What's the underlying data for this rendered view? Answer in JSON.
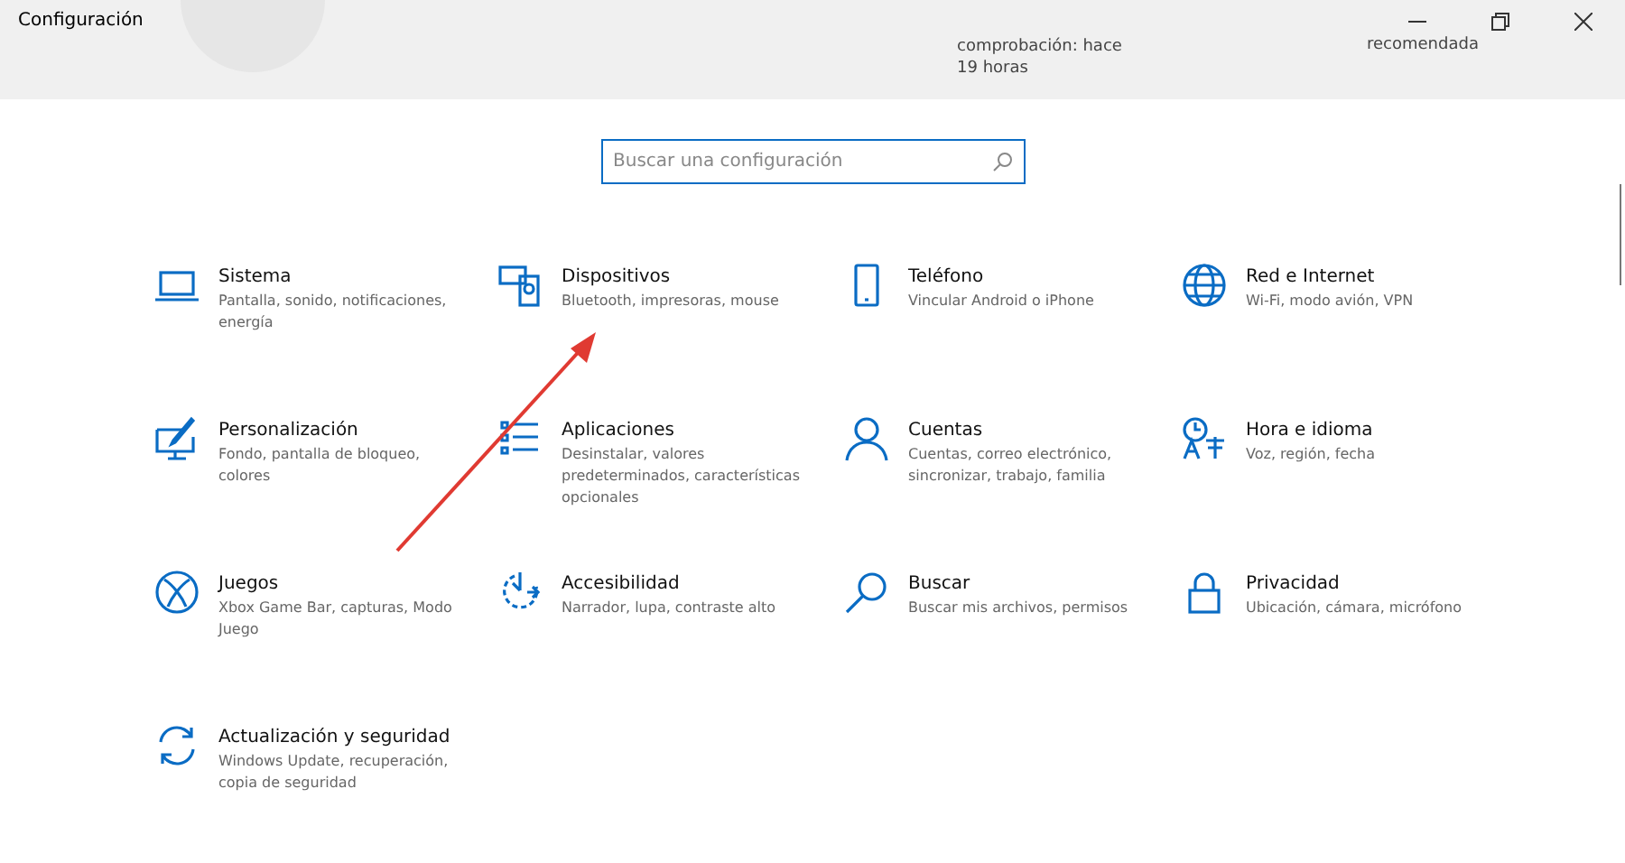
{
  "window": {
    "title": "Configuración"
  },
  "header": {
    "update_status": [
      "comprobación: hace",
      "19 horas"
    ],
    "recommended": "recomendada"
  },
  "search": {
    "placeholder": "Buscar una configuración"
  },
  "categories": [
    {
      "kind": "laptop",
      "title": "Sistema",
      "description": "Pantalla, sonido, notificaciones, energía"
    },
    {
      "kind": "devices",
      "title": "Dispositivos",
      "description": "Bluetooth, impresoras, mouse"
    },
    {
      "kind": "phone",
      "title": "Teléfono",
      "description": "Vincular Android o iPhone"
    },
    {
      "kind": "globe",
      "title": "Red e Internet",
      "description": "Wi-Fi, modo avión, VPN"
    },
    {
      "kind": "brush",
      "title": "Personalización",
      "description": "Fondo, pantalla de bloqueo, colores"
    },
    {
      "kind": "list",
      "title": "Aplicaciones",
      "description": "Desinstalar, valores predeterminados, características opcionales"
    },
    {
      "kind": "person",
      "title": "Cuentas",
      "description": "Cuentas, correo electrónico, sincronizar, trabajo, familia"
    },
    {
      "kind": "language",
      "title": "Hora e idioma",
      "description": "Voz, región, fecha"
    },
    {
      "kind": "xbox",
      "title": "Juegos",
      "description": "Xbox Game Bar, capturas, Modo Juego"
    },
    {
      "kind": "access",
      "title": "Accesibilidad",
      "description": "Narrador, lupa, contraste alto"
    },
    {
      "kind": "search",
      "title": "Buscar",
      "description": "Buscar mis archivos, permisos"
    },
    {
      "kind": "lock",
      "title": "Privacidad",
      "description": "Ubicación, cámara, micrófono"
    },
    {
      "kind": "sync",
      "title": "Actualización y seguridad",
      "description": "Windows Update, recuperación, copia de seguridad"
    }
  ]
}
